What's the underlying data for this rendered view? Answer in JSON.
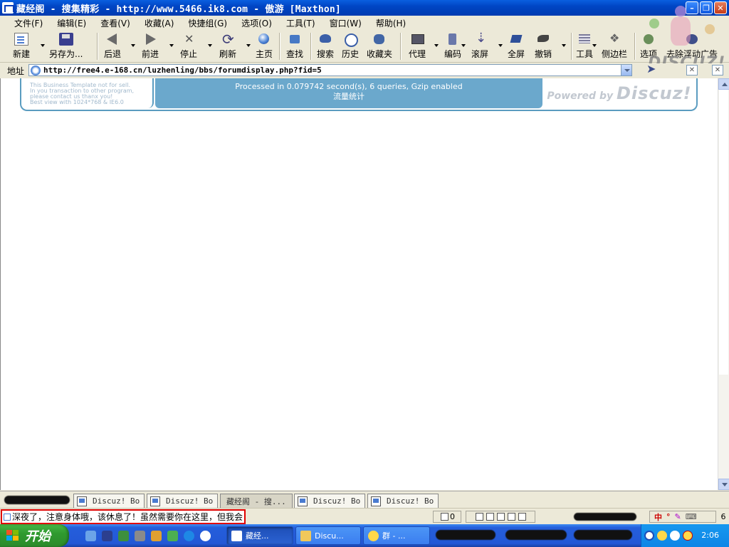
{
  "window": {
    "title": "藏经阁 - 搜集精彩 - http://www.5466.ik8.com - 傲游 [Maxthon]"
  },
  "menu": [
    "文件(F)",
    "编辑(E)",
    "查看(V)",
    "收藏(A)",
    "快捷组(G)",
    "选项(O)",
    "工具(T)",
    "窗口(W)",
    "帮助(H)"
  ],
  "toolbar": {
    "new": "新建",
    "save_as": "另存为...",
    "back": "后退",
    "forward": "前进",
    "stop": "停止",
    "refresh": "刷新",
    "home": "主页",
    "find": "查找",
    "search": "搜索",
    "history": "历史",
    "favorites": "收藏夹",
    "proxy": "代理",
    "encoding": "编码",
    "scroll": "滚屏",
    "fullscreen": "全屏",
    "undo": "撤销",
    "tools": "工具",
    "sidebar": "侧边栏",
    "options": "选项",
    "remove_ads": "去除浮动广告"
  },
  "logo_text": "DISCUZ!",
  "address": {
    "label": "地址",
    "url": "http://free4.e-168.cn/luzhenling/bbs/forumdisplay.php?fid=5"
  },
  "footer": {
    "left_lines": [
      "This Business Template not for sell.",
      "In you transaction to other program,",
      "please contact us thanx you!",
      "Best view with 1024*768 & IE6.0"
    ],
    "processed": "Processed in 0.079742 second(s), 6 queries, Gzip enabled",
    "stats": "流量统计",
    "powered_prefix": "Powered by",
    "powered_brand": "Discuz!"
  },
  "tabs": [
    {
      "label": "Discuz! Bo",
      "active": false
    },
    {
      "label": "Discuz! Bo",
      "active": false
    },
    {
      "label": "藏经阁 - 搜...",
      "active": true
    },
    {
      "label": "Discuz! Bo",
      "active": false
    },
    {
      "label": "Discuz! Bo",
      "active": false
    }
  ],
  "status": {
    "message": "深夜了，注意身体哦，该休息了！虽然需要你在这里，但我会",
    "count": "0",
    "ime_count": "6",
    "ime_label": "中"
  },
  "taskbar": {
    "start": "开始",
    "tasks": [
      {
        "label": "藏经...",
        "active": true
      },
      {
        "label": "Discu...",
        "active": false
      },
      {
        "label": "群 - ...",
        "active": false
      }
    ],
    "clock": "2:06"
  },
  "colors": {
    "title_blue": "#0045c4",
    "forum_blue": "#6ba8cc",
    "status_highlight": "#e00000",
    "start_green": "#2f9a2f"
  }
}
